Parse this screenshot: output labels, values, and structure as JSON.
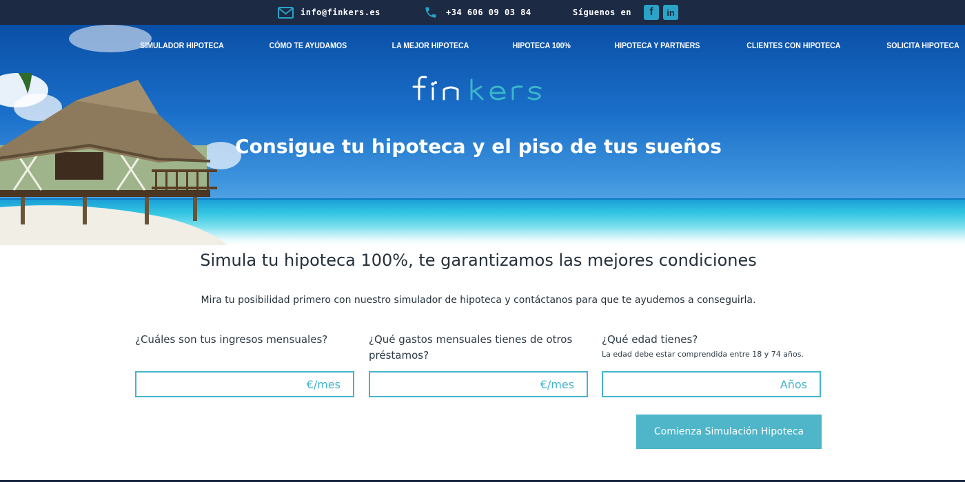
{
  "topbar": {
    "email": "info@finkers.es",
    "phone": "+34 606 09 03 84",
    "follow_label": "Síguenos en",
    "social": [
      {
        "icon": "facebook-icon",
        "glyph": "f"
      },
      {
        "icon": "linkedin-icon",
        "glyph": "in"
      }
    ]
  },
  "nav": {
    "items": [
      "SIMULADOR HIPOTECA",
      "CÓMO TE AYUDAMOS",
      "LA MEJOR HIPOTECA",
      "HIPOTECA 100%",
      "HIPOTECA Y PARTNERS",
      "CLIENTES CON HIPOTECA",
      "SOLICITA HIPOTECA"
    ]
  },
  "hero": {
    "logo_text": "finkers",
    "title": "Consigue tu hipoteca y el piso de tus sueños"
  },
  "simulator": {
    "title": "Simula tu hipoteca 100%, te garantizamos las mejores condiciones",
    "subtitle": "Mira tu posibilidad primero con nuestro simulador de hipoteca y contáctanos para que te ayudemos a conseguirla.",
    "fields": [
      {
        "label": "¿Cuáles son tus ingresos mensuales?",
        "hint": "",
        "value": "",
        "placeholder": "€/mes"
      },
      {
        "label": "¿Qué gastos mensuales tienes de otros préstamos?",
        "hint": "",
        "value": "",
        "placeholder": "€/mes"
      },
      {
        "label": "¿Qué edad tienes?",
        "hint": "La edad debe estar comprendida entre 18 y 74 años.",
        "value": "",
        "placeholder": "Años"
      }
    ],
    "cta_label": "Comienza Simulación Hipoteca"
  },
  "colors": {
    "topbar_bg": "#1c2a44",
    "accent": "#4fb5c9",
    "input_border": "#45b3cc",
    "text": "#24303a"
  }
}
